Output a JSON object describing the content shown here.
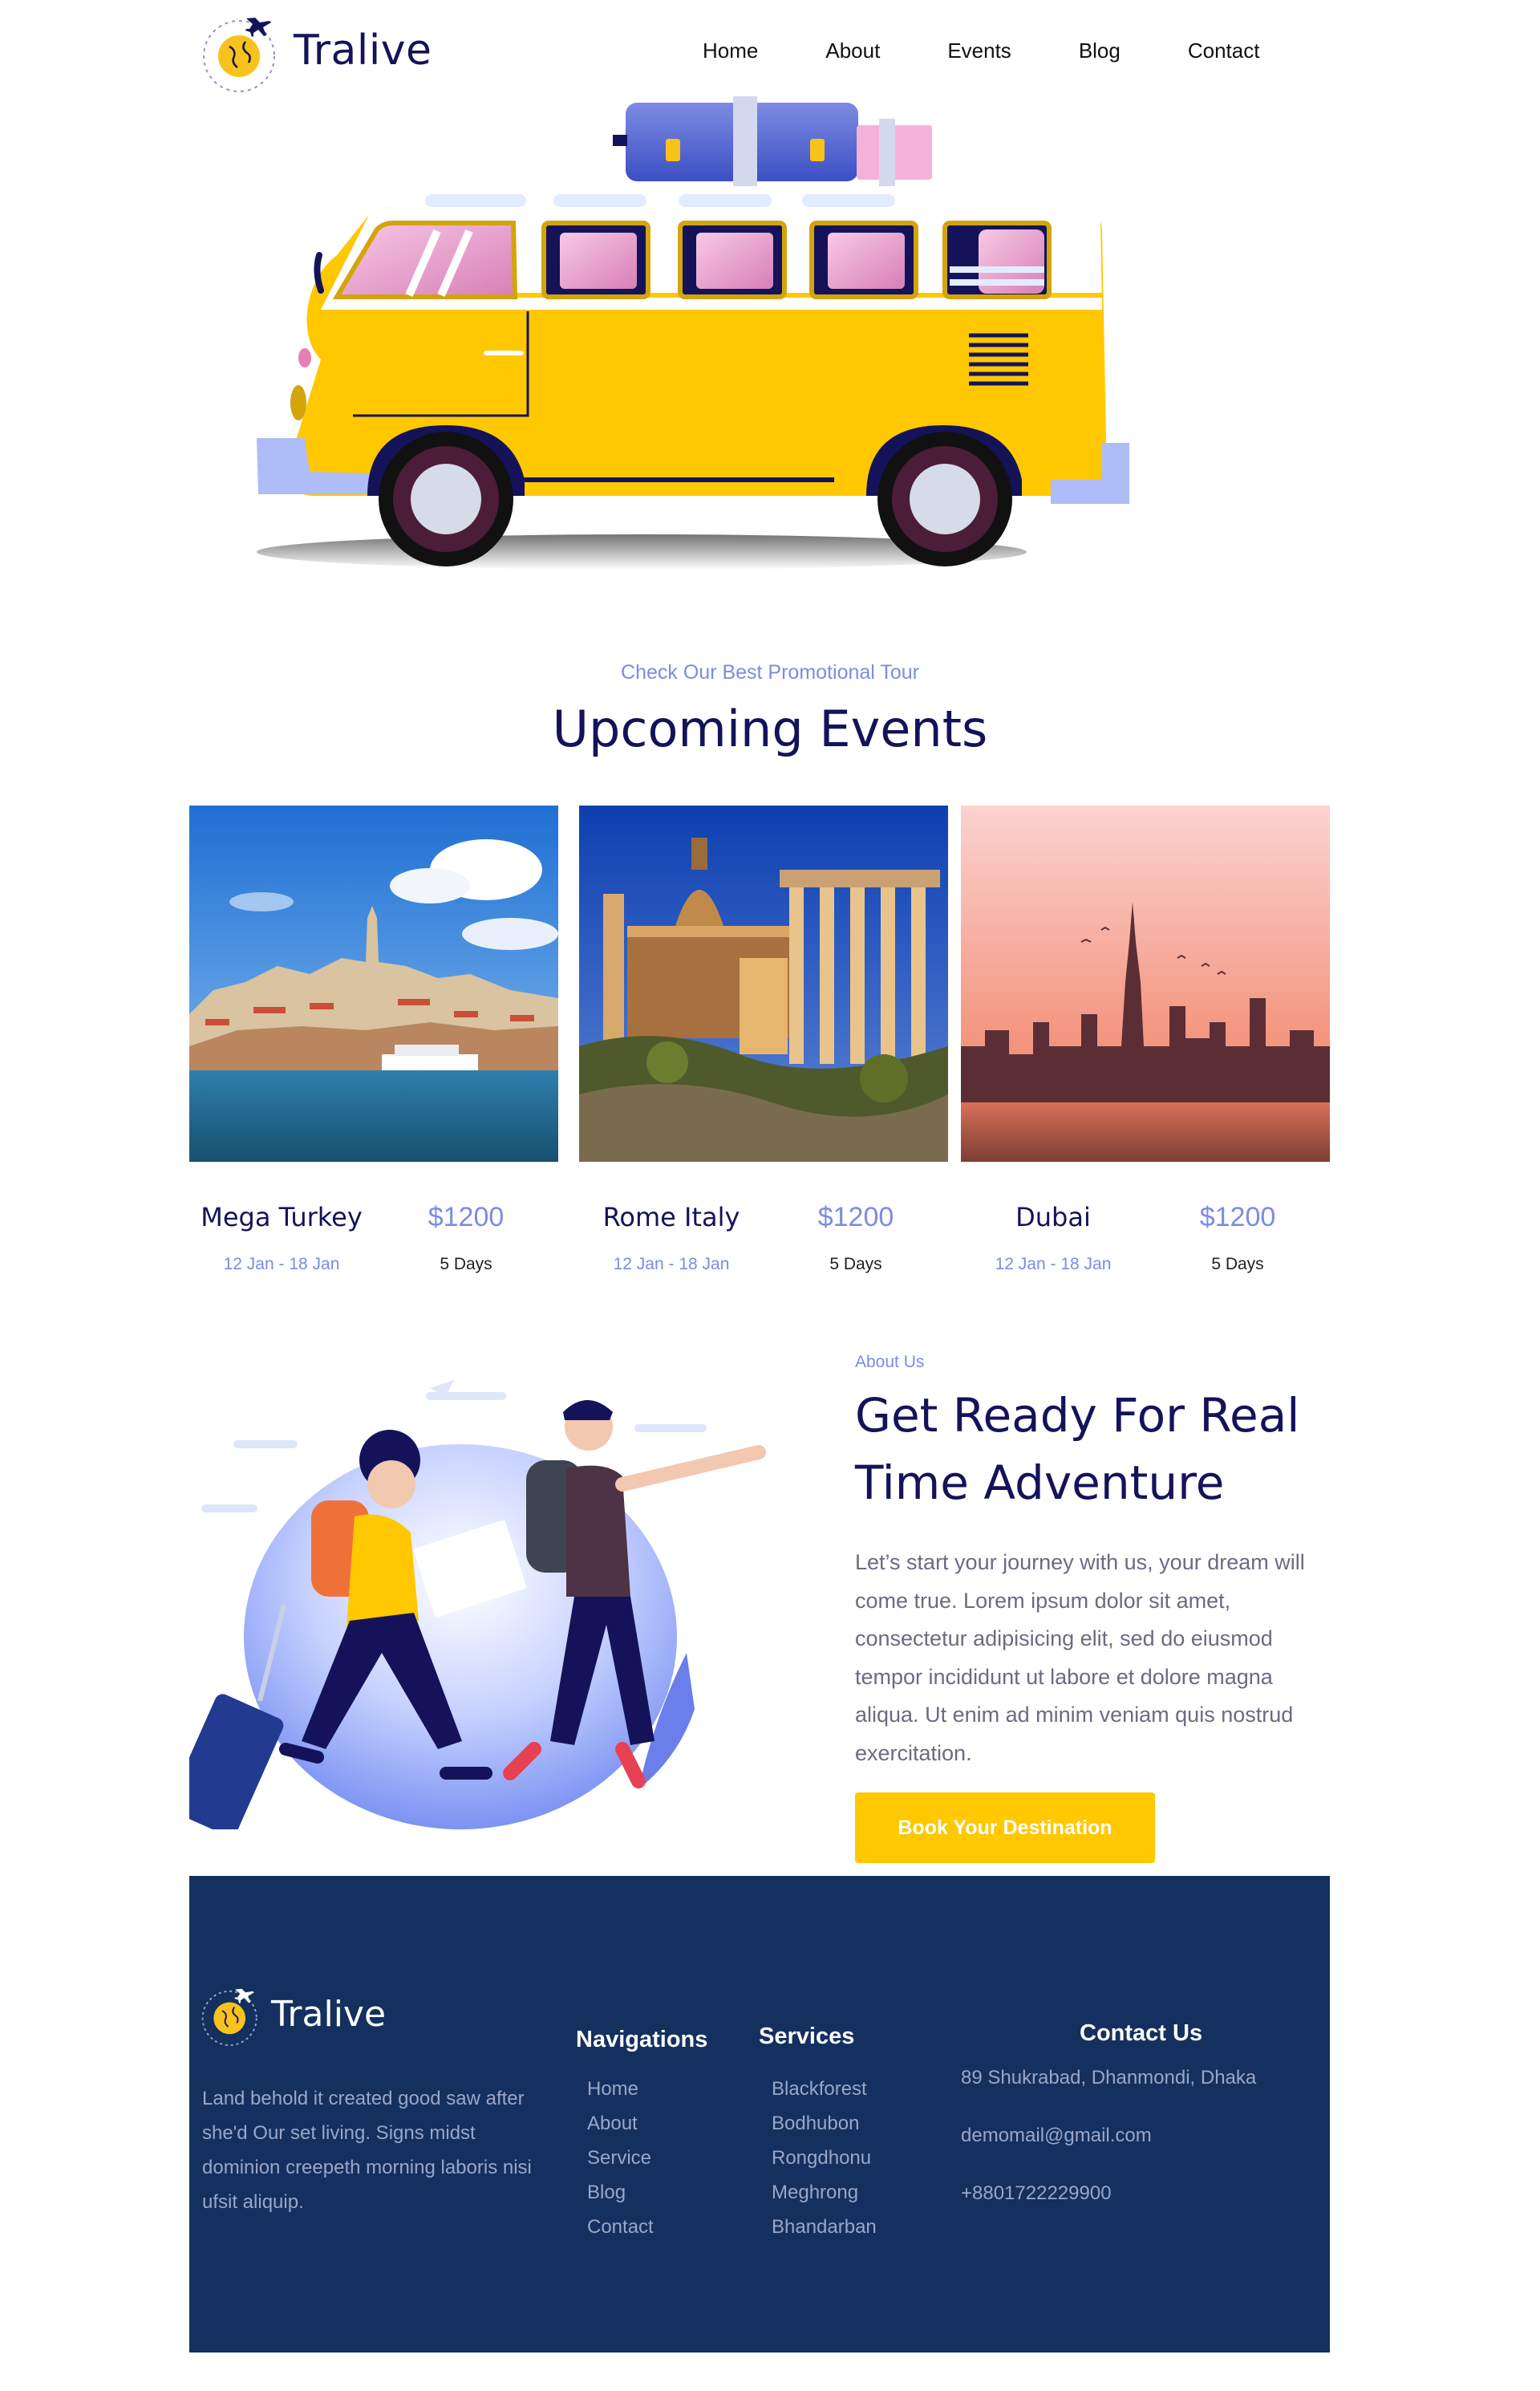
{
  "header": {
    "brand": "Tralive",
    "nav": [
      "Home",
      "About",
      "Events",
      "Blog",
      "Contact"
    ]
  },
  "events": {
    "eyebrow": "Check Our Best Promotional Tour",
    "title": "Upcoming Events",
    "cards": [
      {
        "name": "Mega Turkey",
        "price": "$1200",
        "dates": "12 Jan - 18 Jan",
        "duration": "5 Days"
      },
      {
        "name": "Rome Italy",
        "price": "$1200",
        "dates": "12 Jan - 18 Jan",
        "duration": "5 Days"
      },
      {
        "name": "Dubai",
        "price": "$1200",
        "dates": "12 Jan - 18 Jan",
        "duration": "5 Days"
      }
    ]
  },
  "about": {
    "eyebrow": "About Us",
    "title": "Get Ready For Real Time Adventure",
    "body": "Let’s start your journey with us, your dream will come true. Lorem ipsum dolor sit amet, consectetur adipisicing elit, sed do eiusmod tempor incididunt ut labore et dolore magna aliqua. Ut enim ad minim veniam quis nostrud exercitation.",
    "button": "Book Your Destination"
  },
  "footer": {
    "brand": "Tralive",
    "description": "Land behold it created good saw after she'd Our set living. Signs midst dominion creepeth morning laboris nisi ufsit aliquip.",
    "navigations": {
      "title": "Navigations",
      "items": [
        "Home",
        "About",
        "Service",
        "Blog",
        "Contact"
      ]
    },
    "services": {
      "title": "Services",
      "items": [
        "Blackforest",
        "Bodhubon",
        "Rongdhonu",
        "Meghrong",
        "Bhandarban"
      ]
    },
    "contact": {
      "title": "Contact Us",
      "address": "89 Shukrabad, Dhanmondi, Dhaka",
      "email": "demomail@gmail.com",
      "phone": "+8801722229900"
    }
  },
  "colors": {
    "navy": "#14135a",
    "accent_blue": "#7c8ce3",
    "yellow": "#ffc800",
    "footer_bg": "#13305f"
  }
}
